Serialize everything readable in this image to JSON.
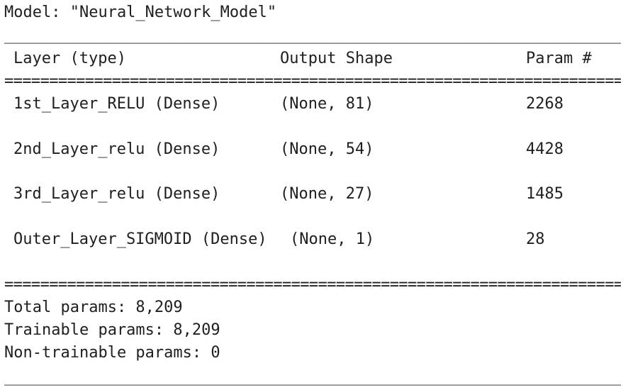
{
  "model_line": "Model: \"Neural_Network_Model\"",
  "rule_underscore": "________________________________________________________________________________________________________",
  "rule_equals": "============================================================================================================",
  "header": {
    "layer": "Layer (type)",
    "shape": "Output Shape",
    "param": "Param #"
  },
  "layers": [
    {
      "name": "1st_Layer_RELU (Dense)",
      "shape": "(None, 81)",
      "params": "2268"
    },
    {
      "name": "2nd_Layer_relu (Dense)",
      "shape": "(None, 54)",
      "params": "4428"
    },
    {
      "name": "3rd_Layer_relu (Dense)",
      "shape": "(None, 27)",
      "params": "1485"
    },
    {
      "name": "Outer_Layer_SIGMOID (Dense)",
      "shape": "(None, 1)",
      "params": "28"
    }
  ],
  "totals": {
    "total": "Total params: 8,209",
    "trainable": "Trainable params: 8,209",
    "non_trainable": "Non-trainable params: 0"
  }
}
